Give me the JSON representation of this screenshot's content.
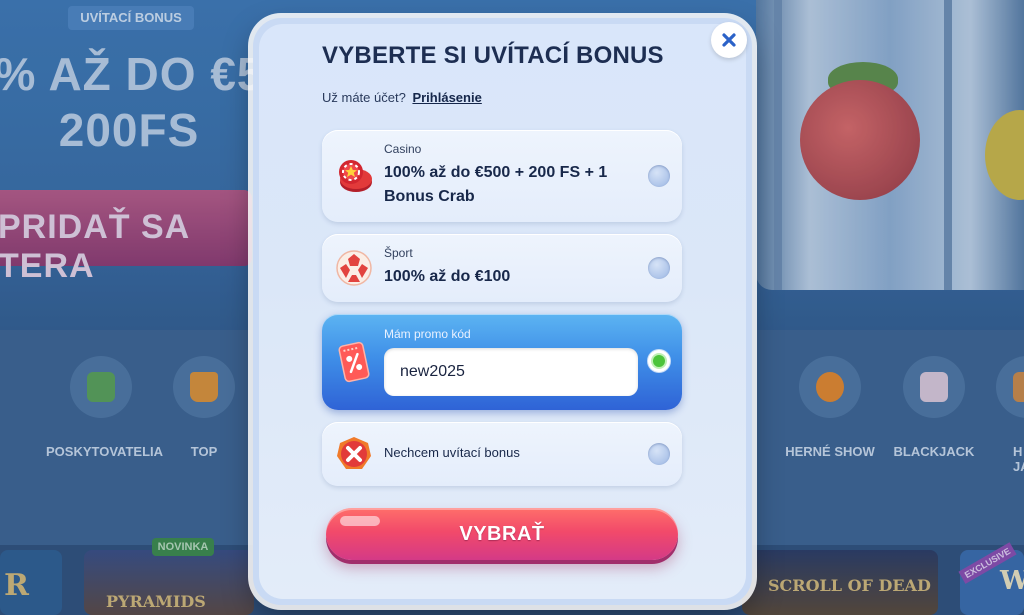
{
  "background": {
    "hero_tag": "UVÍTACÍ BONUS",
    "hero_title_line1": "% AŽ DO €5",
    "hero_title_line2": "200FS",
    "hero_cta": "PRIDAŤ SA TERA",
    "categories": [
      {
        "label": "POSKYTOVATELIA",
        "icon": "book-heart-icon"
      },
      {
        "label": "TOP",
        "icon": "crown-icon"
      },
      {
        "label": "HERNÉ SHOW",
        "icon": "orange-slice-icon"
      },
      {
        "label": "BLACKJACK",
        "icon": "cards-icon"
      },
      {
        "label": "H JA",
        "icon": "partial-category-icon"
      }
    ],
    "games": {
      "new_tag": "NOVINKA",
      "tile_left_text": "R",
      "tile_pyramids_text": "PYRAMIDS",
      "tile_scroll_text": "SCROLL OF DEAD",
      "exclusive_tag": "EXCLUSIVE",
      "tile_right_text": "W"
    }
  },
  "modal": {
    "title": "VYBERTE SI UVÍTACÍ BONUS",
    "account_prompt": "Už máte účet?",
    "login_link": "Prihlásenie",
    "close_icon": "close-icon",
    "options": {
      "casino": {
        "category": "Casino",
        "line1": "100% až do €500 + 200 FS + 1",
        "line2": "Bonus Crab",
        "icon": "casino-chips-icon",
        "selected": false
      },
      "sport": {
        "category": "Šport",
        "line1": "100% až do €100",
        "icon": "football-icon",
        "selected": false
      },
      "promo": {
        "category": "Mám promo kód",
        "value": "new2025",
        "icon": "coupon-percent-icon",
        "selected": true
      },
      "none": {
        "label": "Nechcem uvítací bonus",
        "icon": "red-x-icon",
        "selected": false
      }
    },
    "submit_label": "VYBRAŤ"
  },
  "colors": {
    "accent_blue": "#3f8fe8",
    "submit_pink": "#f24a6a",
    "selected_green": "#4cc43b",
    "title_navy": "#1d2e52"
  }
}
